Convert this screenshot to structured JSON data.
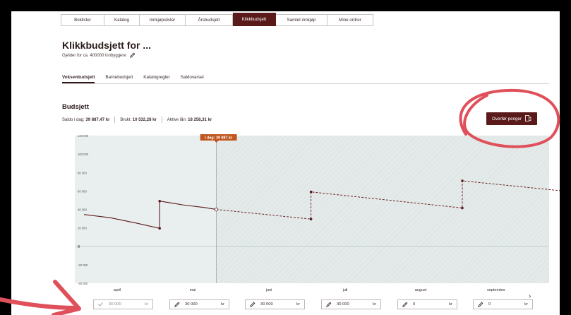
{
  "nav": {
    "tabs": [
      {
        "label": "Boklister"
      },
      {
        "label": "Katalog"
      },
      {
        "label": "Innkjøpslister"
      },
      {
        "label": "Årsbudsjett"
      },
      {
        "label": "Klikkbudsjett"
      },
      {
        "label": "Samlet innkjøp"
      },
      {
        "label": "Mine ordrer"
      }
    ],
    "active_index": 4
  },
  "header": {
    "title": "Klikkbudsjett for ...",
    "subtitle": "Gjelder for ca. 400000 innbyggere"
  },
  "subtabs": [
    {
      "label": "Voksenbudsjett"
    },
    {
      "label": "Barnebudsjett"
    },
    {
      "label": "Katalogregler"
    },
    {
      "label": "Saldovarsel"
    }
  ],
  "budget": {
    "title": "Budsjett",
    "saldo_label": "Saldo i dag:",
    "saldo_value": "39 887,47 kr",
    "used_label": "Brukt:",
    "used_value": "10 532,28 kr",
    "loans_label": "Aktive lån:",
    "loans_value": "18 258,31 kr",
    "transfer_button": "Overfør penger"
  },
  "chart_data": {
    "type": "line",
    "today_label": "I dag: 39 887 kr",
    "yticks": [
      "120 000",
      "100 000",
      "80 000",
      "60 000",
      "40 000",
      "20 000",
      "0",
      "-20 000",
      "-40 000"
    ],
    "ylim": [
      -40000,
      120000
    ],
    "series": [
      {
        "values_actual": [
          [
            0,
            34500
          ],
          [
            0.35,
            31000
          ],
          [
            0.7,
            25000
          ],
          [
            1.0,
            19500
          ],
          [
            1.0,
            49000
          ],
          [
            1.3,
            45000
          ],
          [
            1.6,
            42000
          ],
          [
            1.75,
            39887
          ]
        ],
        "values_forecast": [
          [
            1.75,
            39887
          ],
          [
            3.0,
            29500
          ],
          [
            3.0,
            59000
          ],
          [
            5.0,
            41500
          ],
          [
            5.0,
            71000
          ],
          [
            7.0,
            54500
          ],
          [
            7.0,
            84500
          ],
          [
            11.0,
            40000
          ]
        ]
      }
    ],
    "colors": {
      "actual": "#5a1a1a",
      "forecast": "#6b2323",
      "bg": "#e9efee",
      "label_bg": "#c0571f"
    }
  },
  "months": [
    {
      "label": "april",
      "value": "30 000",
      "unit": "kr",
      "icon": "check-icon",
      "editable": false
    },
    {
      "label": "mai",
      "value": "30 000",
      "unit": "kr",
      "icon": "pencil-icon",
      "editable": true
    },
    {
      "label": "juni",
      "value": "30 000",
      "unit": "kr",
      "icon": "pencil-icon",
      "editable": true
    },
    {
      "label": "juli",
      "value": "30 000",
      "unit": "kr",
      "icon": "pencil-icon",
      "editable": true
    },
    {
      "label": "august",
      "value": "0",
      "unit": "kr",
      "icon": "pencil-icon",
      "editable": true
    },
    {
      "label": "september",
      "value": "0",
      "unit": "kr",
      "icon": "pencil-icon",
      "editable": true
    }
  ],
  "annotation_color": "#e0505a"
}
